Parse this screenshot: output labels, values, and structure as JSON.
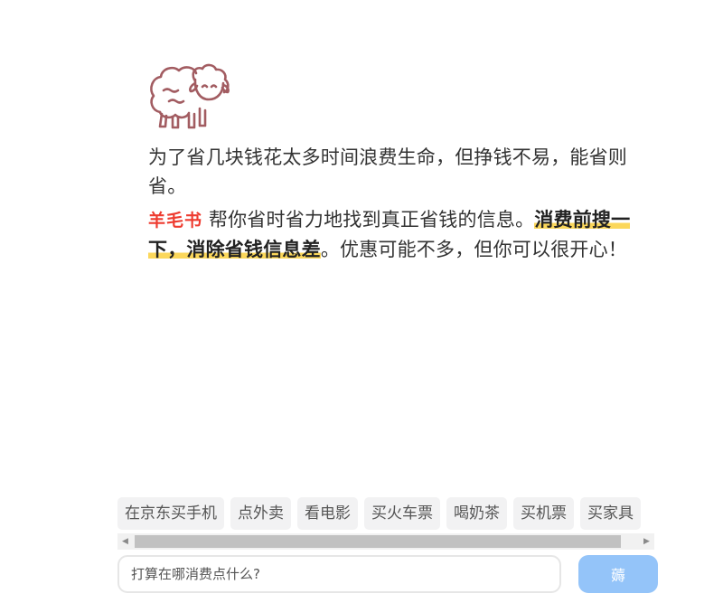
{
  "logo": {
    "icon": "sheep-icon",
    "color": "#a25c61"
  },
  "intro": {
    "p1": "为了省几块钱花太多时间浪费生命，但挣钱不易，能省则省。",
    "brand": "羊毛书",
    "p2_middle": "帮你省时省力地找到真正省钱的信息。",
    "p2_highlight": "消费前搜一下，消除省钱信息差",
    "p2_end": "。优惠可能不多，但你可以很开心！"
  },
  "colors": {
    "brand": "#ee3b2f",
    "highlight": "#fbd75b",
    "button": "#94c4f9"
  },
  "suggestions": [
    "在京东买手机",
    "点外卖",
    "看电影",
    "买火车票",
    "喝奶茶",
    "买机票",
    "买家具"
  ],
  "search": {
    "placeholder": "打算在哪消费点什么?",
    "value": ""
  },
  "submit": {
    "label": "薅"
  }
}
